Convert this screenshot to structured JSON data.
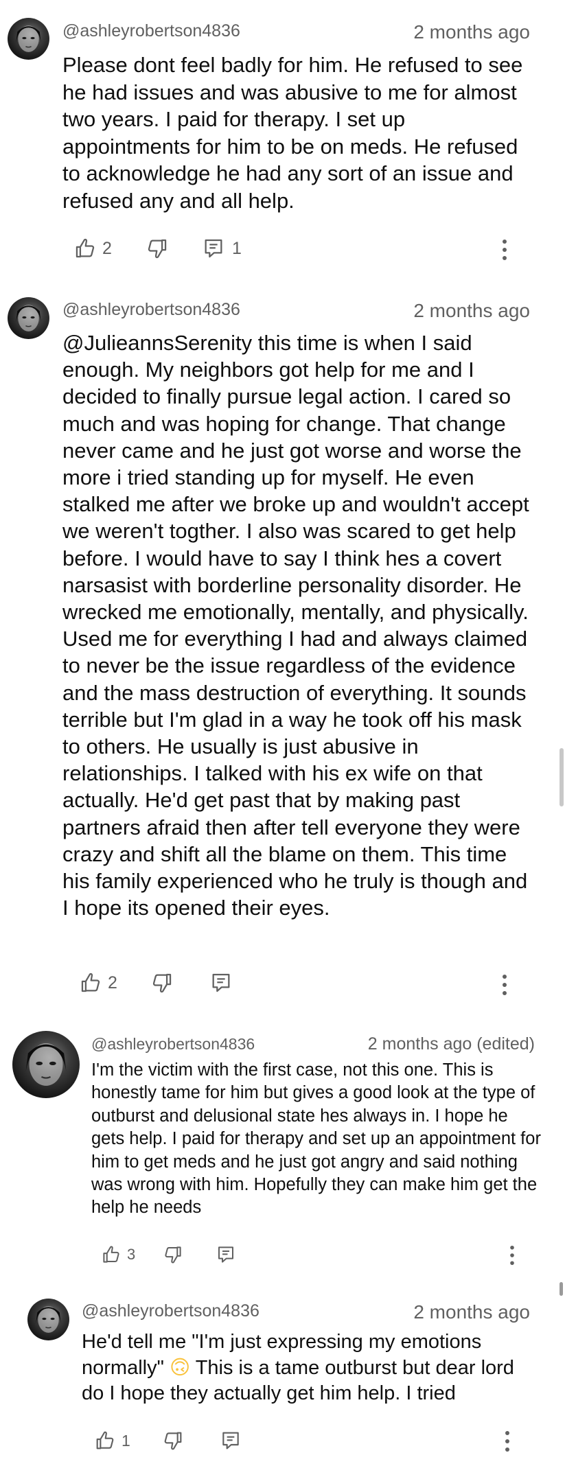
{
  "comments": [
    {
      "handle": "@ashleyrobertson4836",
      "time": "2 months ago",
      "text": "Please dont feel badly for him. He refused to see he had issues and was abusive to me for almost two years. I paid for therapy. I set up appointments for him to be on meds. He refused to acknowledge he had any sort of an issue and refused any and all help.",
      "likes": "2",
      "replies": "1"
    },
    {
      "handle": "@ashleyrobertson4836",
      "time": "2 months ago",
      "text": "@JulieannsSerenity this time is when I said enough. My neighbors got help for me and I decided to finally pursue legal action. I cared so much and was hoping for change. That change never came and he just got worse and worse the more i tried standing up for myself. He even stalked me after we broke up and wouldn't accept we weren't togther. I also was scared to get help before. I would have to say I think hes a covert narsasist with borderline personality disorder. He wrecked me emotionally, mentally, and physically. Used me for everything I had and always claimed to never be the issue regardless of the evidence and the mass destruction of everything. It sounds terrible but I'm glad in a way he took off his mask to others. He usually is just abusive in relationships. I talked with his ex wife on that actually. He'd get past that by making past partners afraid then after tell everyone they were crazy and shift all the blame on them. This time his family experienced who he truly is though and I hope its opened their eyes.",
      "likes": "2"
    },
    {
      "handle": "@ashleyrobertson4836",
      "time": "2 months ago (edited)",
      "text": "I'm the victim with the first case, not this one. This is honestly tame for him but gives a good look at the type of outburst and delusional state hes always in. I hope he gets help. I paid for therapy and set up an appointment for him to get meds and he just got angry and said nothing was wrong with him. Hopefully they can make him get the help he needs",
      "likes": "3"
    },
    {
      "handle": "@ashleyrobertson4836",
      "time": "2 months ago",
      "text_before_emoji": "He'd tell me \"I'm just expressing my emotions normally\" ",
      "emoji": "🙃",
      "text_after_emoji": " This is a tame outburst but dear lord do I hope they actually get him help. I tried",
      "likes": "1"
    }
  ],
  "icons": {
    "like": "thumbs-up-icon",
    "dislike": "thumbs-down-icon",
    "reply": "reply-comment-icon",
    "more": "more-vertical-icon",
    "emoji_color": "#f9c23c"
  }
}
